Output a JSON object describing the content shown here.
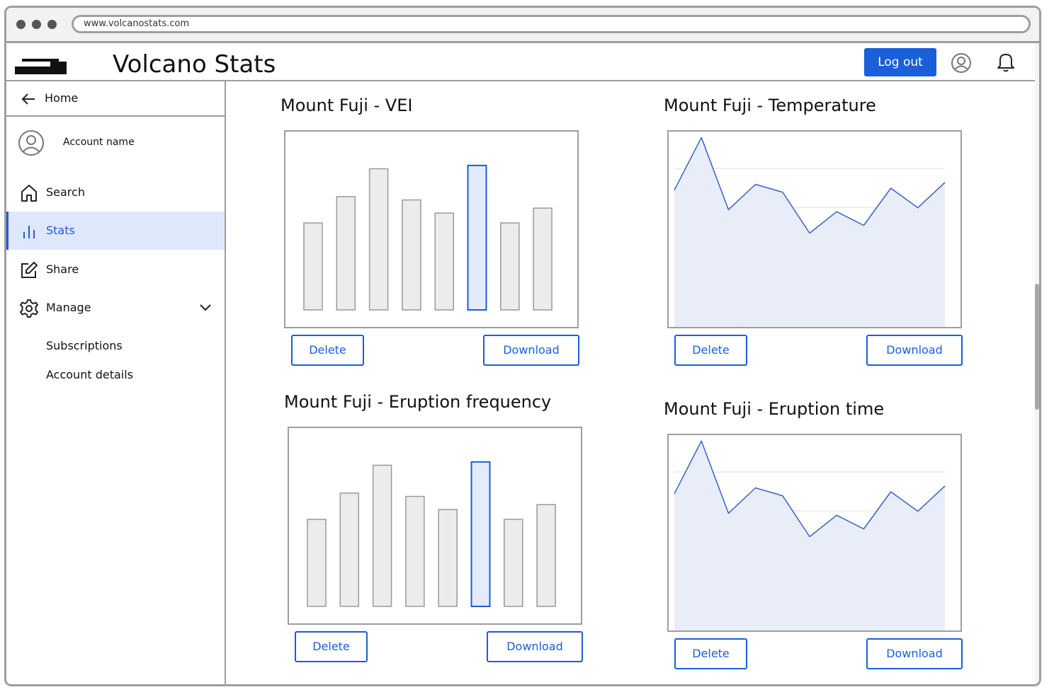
{
  "browser": {
    "url": "www.volcanostats.com"
  },
  "header": {
    "app_title": "Volcano Stats",
    "logout_label": "Log out",
    "accent_color": "#1a5fd8"
  },
  "sidebar": {
    "home_label": "Home",
    "account_name": "Account name",
    "items": [
      {
        "label": "Search",
        "icon": "home-icon",
        "active": false
      },
      {
        "label": "Stats",
        "icon": "bar-chart-icon",
        "active": true
      },
      {
        "label": "Share",
        "icon": "edit-icon",
        "active": false
      },
      {
        "label": "Manage",
        "icon": "gear-icon",
        "active": false,
        "expanded": true
      }
    ],
    "sub_items": [
      "Subscriptions",
      "Account details"
    ]
  },
  "cards": [
    {
      "title": "Mount Fuji - VEI",
      "delete_label": "Delete",
      "download_label": "Download"
    },
    {
      "title": "Mount Fuji - Temperature",
      "delete_label": "Delete",
      "download_label": "Download"
    },
    {
      "title": "Mount Fuji - Eruption frequency",
      "delete_label": "Delete",
      "download_label": "Download"
    },
    {
      "title": "Mount Fuji - Eruption time",
      "delete_label": "Delete",
      "download_label": "Download"
    }
  ],
  "chart_data": [
    {
      "type": "bar",
      "title": "Mount Fuji - VEI",
      "values": [
        5.3,
        6.9,
        8.6,
        6.7,
        5.9,
        8.8,
        5.3,
        6.2
      ],
      "highlight_index": 5,
      "ylim": [
        0,
        10
      ]
    },
    {
      "type": "area",
      "title": "Mount Fuji - Temperature",
      "values": [
        7.0,
        9.7,
        6.0,
        7.3,
        6.9,
        4.8,
        5.9,
        5.2,
        7.1,
        6.1,
        7.4
      ],
      "ylim": [
        0,
        10
      ],
      "grid": true
    },
    {
      "type": "bar",
      "title": "Mount Fuji - Eruption frequency",
      "values": [
        5.3,
        6.9,
        8.6,
        6.7,
        5.9,
        8.8,
        5.3,
        6.2
      ],
      "highlight_index": 5,
      "ylim": [
        0,
        10
      ]
    },
    {
      "type": "area",
      "title": "Mount Fuji - Eruption time",
      "values": [
        7.0,
        9.7,
        6.0,
        7.3,
        6.9,
        4.8,
        5.9,
        5.2,
        7.1,
        6.1,
        7.4
      ],
      "ylim": [
        0,
        10
      ],
      "grid": true
    }
  ]
}
